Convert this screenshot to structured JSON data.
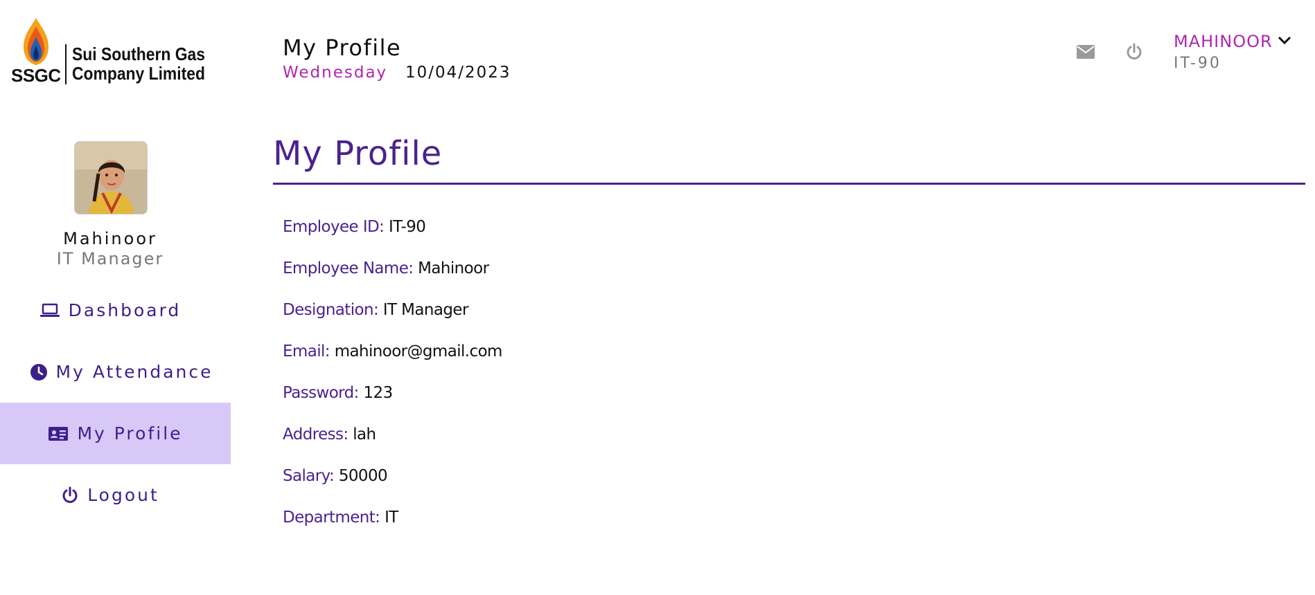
{
  "header": {
    "logo": {
      "ssgc": "SSGC",
      "company_line1": "Sui Southern Gas",
      "company_line2": "Company Limited"
    },
    "title": "My Profile",
    "day": "Wednesday",
    "date": "10/04/2023",
    "icons": {
      "mail": "envelope-icon",
      "power": "power-icon"
    },
    "user": {
      "name": "MAHINOOR",
      "id": "IT-90"
    }
  },
  "sidebar": {
    "name": "Mahinoor",
    "role": "IT Manager",
    "items": [
      {
        "label": "Dashboard",
        "icon": "laptop-icon",
        "active": false
      },
      {
        "label": "My Attendance",
        "icon": "clock-icon",
        "active": false
      },
      {
        "label": "My Profile",
        "icon": "id-card-icon",
        "active": true
      },
      {
        "label": "Logout",
        "icon": "power-icon",
        "active": false
      }
    ]
  },
  "main": {
    "title": "My Profile",
    "fields": [
      {
        "label": "Employee ID:",
        "value": "IT-90"
      },
      {
        "label": "Employee Name:",
        "value": "Mahinoor"
      },
      {
        "label": "Designation:",
        "value": "IT Manager"
      },
      {
        "label": "Email:",
        "value": "mahinoor@gmail.com"
      },
      {
        "label": "Password:",
        "value": "123"
      },
      {
        "label": "Address:",
        "value": "lah"
      },
      {
        "label": "Salary:",
        "value": "50000"
      },
      {
        "label": "Department:",
        "value": "IT"
      }
    ]
  },
  "colors": {
    "accent": "#4a2290",
    "magenta": "#b026b0",
    "active_bg": "#d8c8f8"
  }
}
